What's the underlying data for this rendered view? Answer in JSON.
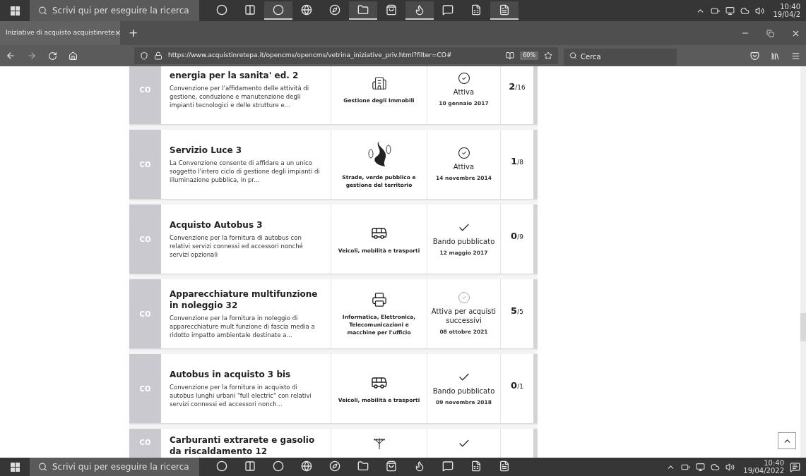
{
  "top_taskbar": {
    "search_placeholder": "Scrivi qui per eseguire la ricerca",
    "time": "10:40",
    "date": "19/04/2",
    "apps": [
      {
        "kind": "cortana",
        "running": false
      },
      {
        "kind": "taskview",
        "running": false
      },
      {
        "kind": "chrome",
        "running": true
      },
      {
        "kind": "edge",
        "running": false
      },
      {
        "kind": "ie",
        "running": false
      },
      {
        "kind": "folder",
        "running": true
      },
      {
        "kind": "store",
        "running": false
      },
      {
        "kind": "firefox",
        "running": true
      },
      {
        "kind": "chat",
        "running": false
      },
      {
        "kind": "excel",
        "running": false
      },
      {
        "kind": "word",
        "running": true
      }
    ]
  },
  "browser": {
    "tab_title": "Iniziative di acquisto  acquistinrete",
    "close": "×",
    "new_tab": "+",
    "url": "https://www.acquistinretepa.it/opencms/opencms/vetrina_iniziative_priv.html?filter=CO#",
    "zoom": "60%",
    "search_placeholder": "Cerca"
  },
  "cards": [
    {
      "badge": "CO",
      "title": "energia per la sanita' ed. 2",
      "description": "Convenzione per l'affidamento delle attività di gestione, conduzione e manutenzione degli impianti tecnologici e delle strutture e...",
      "category": {
        "kind": "building",
        "label": "Gestione degli Immobili"
      },
      "status": {
        "kind": "active",
        "label": "Attiva",
        "date": "10 gennaio 2017"
      },
      "count": "2",
      "total": "/16"
    },
    {
      "badge": "CO",
      "title": "Servizio Luce 3",
      "description": "La Convenzione consente di affidare a un unico soggetto l'intero ciclo di gestione degli impianti di illuminazione pubblica, in pr...",
      "category": {
        "kind": "road",
        "label": "Strade, verde pubblico e gestione del territorio"
      },
      "status": {
        "kind": "active",
        "label": "Attiva",
        "date": "14 novembre 2014"
      },
      "count": "1",
      "total": "/8"
    },
    {
      "badge": "CO",
      "title": "Acquisto Autobus 3",
      "description": "Convenzione per la fornitura di autobus con relativi servizi connessi ed accessori nonché servizi opzionali",
      "category": {
        "kind": "vehicles",
        "label": "Veicoli, mobilità e trasporti"
      },
      "status": {
        "kind": "published",
        "label": "Bando pubblicato",
        "date": "12 maggio 2017"
      },
      "count": "0",
      "total": "/9"
    },
    {
      "badge": "CO",
      "title": "Apparecchiature multifunzione in noleggio 32",
      "description": "Convenzione per la fornitura in noleggio di apparecchiature mult funzione di fascia media a ridotto impatto ambientale destinate a...",
      "category": {
        "kind": "printer",
        "label": "Informatica, Elettronica, Telecomunicazioni e macchine per l'ufficio"
      },
      "status": {
        "kind": "successive",
        "label": "Attiva per acquisti successivi",
        "date": "08 ottobre 2021"
      },
      "count": "5",
      "total": "/5"
    },
    {
      "badge": "CO",
      "title": "Autobus in acquisto 3 bis",
      "description": "Convenzione per la fornitura in acquisto di autobus lunghi urbani \"full electric\" con relativi servizi connessi ed accessori nonch...",
      "category": {
        "kind": "vehicles",
        "label": "Veicoli, mobilità e trasporti"
      },
      "status": {
        "kind": "published",
        "label": "Bando pubblicato",
        "date": "09 novembre 2018"
      },
      "count": "0",
      "total": "/1"
    },
    {
      "badge": "CO",
      "title": "Carburanti extrarete e gasolio da riscaldamento 12",
      "category": {
        "kind": "pylon"
      },
      "status": {
        "kind": "published"
      }
    }
  ],
  "bottom_taskbar": {
    "search_placeholder": "Scrivi qui per eseguire la ricerca",
    "time": "10:40",
    "date": "19/04/2022",
    "apps": [
      {
        "kind": "cortana",
        "running": false
      },
      {
        "kind": "taskview",
        "running": false
      },
      {
        "kind": "chrome",
        "running": false
      },
      {
        "kind": "edge",
        "running": false
      },
      {
        "kind": "ie",
        "running": false
      },
      {
        "kind": "folder",
        "running": false
      },
      {
        "kind": "store",
        "running": false
      },
      {
        "kind": "firefox",
        "running": false
      },
      {
        "kind": "chat",
        "running": false
      },
      {
        "kind": "excel",
        "running": false
      },
      {
        "kind": "word",
        "running": false
      }
    ]
  }
}
